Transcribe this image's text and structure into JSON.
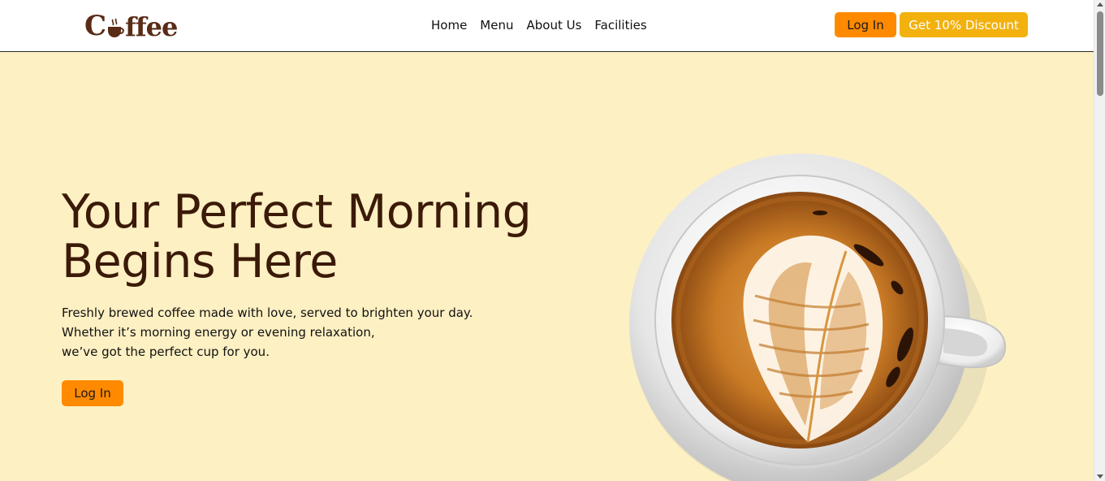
{
  "brand": {
    "logo_prefix": "C",
    "logo_suffix": "ffee",
    "logo_color": "#5a2b17"
  },
  "nav": {
    "items": [
      {
        "label": "Home"
      },
      {
        "label": "Menu"
      },
      {
        "label": "About Us"
      },
      {
        "label": "Facilities"
      }
    ]
  },
  "header_actions": {
    "login_label": "Log In",
    "discount_label": "Get 10% Discount"
  },
  "hero": {
    "title_line1": "Your Perfect Morning",
    "title_line2": "Begins Here",
    "desc_line1": "Freshly brewed coffee made with love, served to brighten your day.",
    "desc_line2": "Whether it’s morning energy or evening relaxation,",
    "desc_line3": "we’ve got the perfect cup for you.",
    "cta_label": "Log In",
    "image_icon": "latte-art-cup-icon"
  },
  "colors": {
    "hero_background": "#fdf0c3",
    "primary_button": "#ff8a00",
    "discount_button": "#f2b10d",
    "title_color": "#3b1a08"
  }
}
